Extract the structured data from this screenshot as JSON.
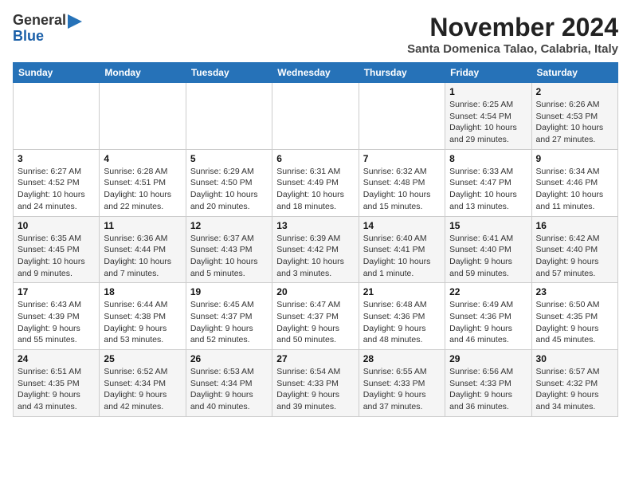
{
  "logo": {
    "general": "General",
    "blue": "Blue",
    "icon": "▶"
  },
  "title": "November 2024",
  "location": "Santa Domenica Talao, Calabria, Italy",
  "weekdays": [
    "Sunday",
    "Monday",
    "Tuesday",
    "Wednesday",
    "Thursday",
    "Friday",
    "Saturday"
  ],
  "weeks": [
    [
      {
        "day": "",
        "info": ""
      },
      {
        "day": "",
        "info": ""
      },
      {
        "day": "",
        "info": ""
      },
      {
        "day": "",
        "info": ""
      },
      {
        "day": "",
        "info": ""
      },
      {
        "day": "1",
        "info": "Sunrise: 6:25 AM\nSunset: 4:54 PM\nDaylight: 10 hours and 29 minutes."
      },
      {
        "day": "2",
        "info": "Sunrise: 6:26 AM\nSunset: 4:53 PM\nDaylight: 10 hours and 27 minutes."
      }
    ],
    [
      {
        "day": "3",
        "info": "Sunrise: 6:27 AM\nSunset: 4:52 PM\nDaylight: 10 hours and 24 minutes."
      },
      {
        "day": "4",
        "info": "Sunrise: 6:28 AM\nSunset: 4:51 PM\nDaylight: 10 hours and 22 minutes."
      },
      {
        "day": "5",
        "info": "Sunrise: 6:29 AM\nSunset: 4:50 PM\nDaylight: 10 hours and 20 minutes."
      },
      {
        "day": "6",
        "info": "Sunrise: 6:31 AM\nSunset: 4:49 PM\nDaylight: 10 hours and 18 minutes."
      },
      {
        "day": "7",
        "info": "Sunrise: 6:32 AM\nSunset: 4:48 PM\nDaylight: 10 hours and 15 minutes."
      },
      {
        "day": "8",
        "info": "Sunrise: 6:33 AM\nSunset: 4:47 PM\nDaylight: 10 hours and 13 minutes."
      },
      {
        "day": "9",
        "info": "Sunrise: 6:34 AM\nSunset: 4:46 PM\nDaylight: 10 hours and 11 minutes."
      }
    ],
    [
      {
        "day": "10",
        "info": "Sunrise: 6:35 AM\nSunset: 4:45 PM\nDaylight: 10 hours and 9 minutes."
      },
      {
        "day": "11",
        "info": "Sunrise: 6:36 AM\nSunset: 4:44 PM\nDaylight: 10 hours and 7 minutes."
      },
      {
        "day": "12",
        "info": "Sunrise: 6:37 AM\nSunset: 4:43 PM\nDaylight: 10 hours and 5 minutes."
      },
      {
        "day": "13",
        "info": "Sunrise: 6:39 AM\nSunset: 4:42 PM\nDaylight: 10 hours and 3 minutes."
      },
      {
        "day": "14",
        "info": "Sunrise: 6:40 AM\nSunset: 4:41 PM\nDaylight: 10 hours and 1 minute."
      },
      {
        "day": "15",
        "info": "Sunrise: 6:41 AM\nSunset: 4:40 PM\nDaylight: 9 hours and 59 minutes."
      },
      {
        "day": "16",
        "info": "Sunrise: 6:42 AM\nSunset: 4:40 PM\nDaylight: 9 hours and 57 minutes."
      }
    ],
    [
      {
        "day": "17",
        "info": "Sunrise: 6:43 AM\nSunset: 4:39 PM\nDaylight: 9 hours and 55 minutes."
      },
      {
        "day": "18",
        "info": "Sunrise: 6:44 AM\nSunset: 4:38 PM\nDaylight: 9 hours and 53 minutes."
      },
      {
        "day": "19",
        "info": "Sunrise: 6:45 AM\nSunset: 4:37 PM\nDaylight: 9 hours and 52 minutes."
      },
      {
        "day": "20",
        "info": "Sunrise: 6:47 AM\nSunset: 4:37 PM\nDaylight: 9 hours and 50 minutes."
      },
      {
        "day": "21",
        "info": "Sunrise: 6:48 AM\nSunset: 4:36 PM\nDaylight: 9 hours and 48 minutes."
      },
      {
        "day": "22",
        "info": "Sunrise: 6:49 AM\nSunset: 4:36 PM\nDaylight: 9 hours and 46 minutes."
      },
      {
        "day": "23",
        "info": "Sunrise: 6:50 AM\nSunset: 4:35 PM\nDaylight: 9 hours and 45 minutes."
      }
    ],
    [
      {
        "day": "24",
        "info": "Sunrise: 6:51 AM\nSunset: 4:35 PM\nDaylight: 9 hours and 43 minutes."
      },
      {
        "day": "25",
        "info": "Sunrise: 6:52 AM\nSunset: 4:34 PM\nDaylight: 9 hours and 42 minutes."
      },
      {
        "day": "26",
        "info": "Sunrise: 6:53 AM\nSunset: 4:34 PM\nDaylight: 9 hours and 40 minutes."
      },
      {
        "day": "27",
        "info": "Sunrise: 6:54 AM\nSunset: 4:33 PM\nDaylight: 9 hours and 39 minutes."
      },
      {
        "day": "28",
        "info": "Sunrise: 6:55 AM\nSunset: 4:33 PM\nDaylight: 9 hours and 37 minutes."
      },
      {
        "day": "29",
        "info": "Sunrise: 6:56 AM\nSunset: 4:33 PM\nDaylight: 9 hours and 36 minutes."
      },
      {
        "day": "30",
        "info": "Sunrise: 6:57 AM\nSunset: 4:32 PM\nDaylight: 9 hours and 34 minutes."
      }
    ]
  ]
}
